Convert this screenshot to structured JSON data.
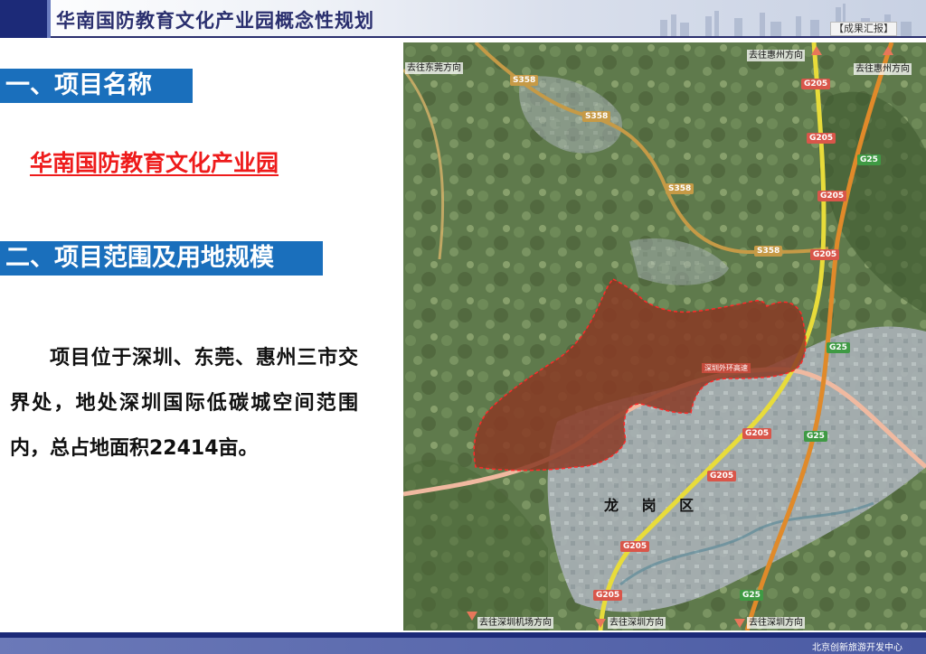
{
  "header": {
    "title": "华南国防教育文化产业园概念性规划",
    "badge": "【成果汇报】"
  },
  "section1": {
    "heading": "一、项目名称",
    "project_name": "华南国防教育文化产业园"
  },
  "section2": {
    "heading": "二、项目范围及用地规模",
    "description": "项目位于深圳、东莞、惠州三市交界处，地处深圳国际低碳城空间范围内，总占地面积22414亩。"
  },
  "map": {
    "labels": {
      "to_dongguan": "去往东莞方向",
      "to_huizhou_top": "去往惠州方向",
      "to_huizhou_right": "去往惠州方向",
      "to_airport": "去往深圳机场方向",
      "to_shenzhen_1": "去往深圳方向",
      "to_shenzhen_2": "去往深圳方向",
      "district": "龙 岗 区",
      "expressway": "深圳外环高速"
    },
    "roads": {
      "s358": "S358",
      "g205": "G205",
      "g25": "G25"
    },
    "colors": {
      "satellite_green": "#5f7a4c",
      "urban": "#aab2b8",
      "project_fill": "#8a3a25",
      "project_border": "#ff2a2a",
      "s_road": "#c69a46",
      "g205_road": "#e8dc3a",
      "g25_road": "#e08a2a",
      "ring_road": "#f0b9a0"
    }
  },
  "footer": {
    "org": "北京创新旅游开发中心"
  }
}
